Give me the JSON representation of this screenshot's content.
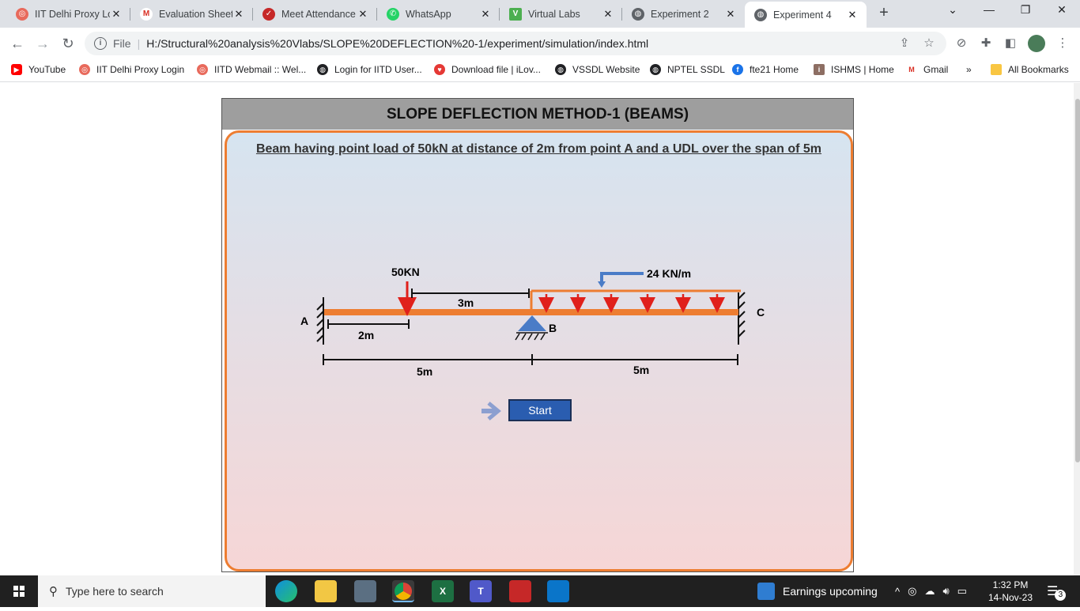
{
  "browser": {
    "tabs": [
      {
        "title": "IIT Delhi Proxy Lo",
        "favicon": "iitd-icon",
        "color": "#e86a5c"
      },
      {
        "title": "Evaluation Sheet",
        "favicon": "gmail-icon",
        "color": "#d93025"
      },
      {
        "title": "Meet Attendance",
        "favicon": "meet-attendance-icon",
        "color": "#c62828"
      },
      {
        "title": "WhatsApp",
        "favicon": "whatsapp-icon",
        "color": "#25d366"
      },
      {
        "title": "Virtual Labs",
        "favicon": "virtual-labs-icon",
        "color": "#4caf50"
      },
      {
        "title": "Experiment 2",
        "favicon": "globe-icon",
        "color": "#5f6368"
      },
      {
        "title": "Experiment 4",
        "favicon": "globe-icon",
        "color": "#5f6368"
      }
    ],
    "new_tab_label": "+",
    "url_scheme": "File",
    "url": "H:/Structural%20analysis%20Vlabs/SLOPE%20DEFLECTION%20-1/experiment/simulation/index.html",
    "bookmarks": [
      {
        "label": "YouTube",
        "icon": "youtube-icon",
        "color": "#ff0000"
      },
      {
        "label": "IIT Delhi Proxy Login",
        "icon": "iitd-icon",
        "color": "#e86a5c"
      },
      {
        "label": "IITD Webmail :: Wel...",
        "icon": "iitd-icon",
        "color": "#e86a5c"
      },
      {
        "label": "Login for IITD User...",
        "icon": "globe-icon",
        "color": "#202124"
      },
      {
        "label": "Download file | iLov...",
        "icon": "ilovepdf-icon",
        "color": "#e53935"
      },
      {
        "label": "VSSDL Website",
        "icon": "globe-icon",
        "color": "#202124"
      },
      {
        "label": "NPTEL SSDL",
        "icon": "globe-icon",
        "color": "#202124"
      },
      {
        "label": "fte21 Home",
        "icon": "fte-icon",
        "color": "#1a73e8"
      },
      {
        "label": "ISHMS | Home",
        "icon": "ishms-icon",
        "color": "#8d6e63"
      },
      {
        "label": "Gmail",
        "icon": "gmail-icon",
        "color": "#d93025"
      }
    ],
    "overflow_label": "»",
    "all_bookmarks": "All Bookmarks"
  },
  "page": {
    "title": "SLOPE DEFLECTION METHOD-1 (BEAMS)",
    "problem": "Beam having point load of 50kN at distance of 2m from point A and a UDL over the span of 5m",
    "diagram": {
      "point_load_label": "50KN",
      "udl_label": "24 KN/m",
      "dim_3m": "3m",
      "dim_2m": "2m",
      "span1": "5m",
      "span2": "5m",
      "support_a": "A",
      "support_b": "B",
      "support_c": "C"
    },
    "start_label": "Start"
  },
  "taskbar": {
    "search_placeholder": "Type here to search",
    "weather": "Earnings upcoming",
    "time": "1:32 PM",
    "date": "14-Nov-23",
    "notifications": "3"
  }
}
